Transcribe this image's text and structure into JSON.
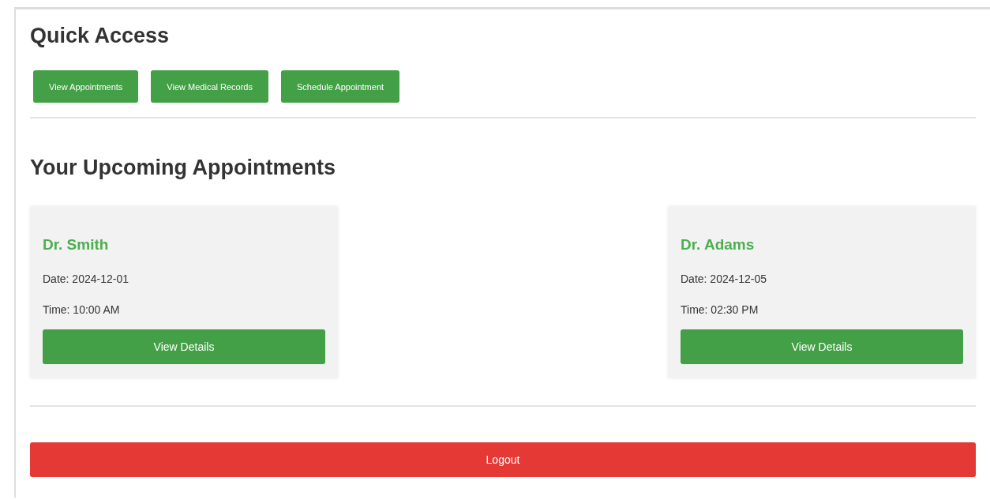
{
  "quick_access": {
    "title": "Quick Access",
    "buttons": [
      "View Appointments",
      "View Medical Records",
      "Schedule Appointment"
    ]
  },
  "appointments": {
    "title": "Your Upcoming Appointments",
    "cards": [
      {
        "doctor": "Dr. Smith",
        "date": "Date: 2024-12-01",
        "time": "Time: 10:00 AM",
        "button": "View Details"
      },
      {
        "doctor": "Dr. Adams",
        "date": "Date: 2024-12-05",
        "time": "Time: 02:30 PM",
        "button": "View Details"
      }
    ]
  },
  "logout": "Logout"
}
